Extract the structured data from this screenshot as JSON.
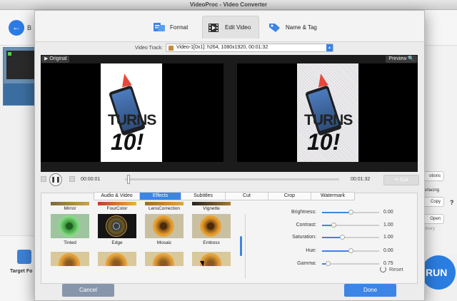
{
  "window_title": "VideoProc - Video Converter",
  "background": {
    "back_label": "B",
    "target_format_label": "Target Fo",
    "right_button_1": "otions",
    "right_text_1": "erlacing",
    "right_button_2": "Copy",
    "right_help": "?",
    "right_button_3": "Open",
    "right_text_2": "ibrary",
    "run_label": "RUN"
  },
  "tabs": [
    {
      "label": "Format",
      "icon": "format-icon"
    },
    {
      "label": "Edit Video",
      "icon": "film-icon"
    },
    {
      "label": "Name & Tag",
      "icon": "tag-icon"
    }
  ],
  "active_tab": "Edit Video",
  "video_track": {
    "label": "Video Track:",
    "value": "Video-1[0x1]: h264, 1080x1920, 00:01:32"
  },
  "preview": {
    "original_label": "Original",
    "preview_label": "Preview",
    "overlay_line1": "TURNS",
    "overlay_line2": "10!"
  },
  "timeline": {
    "current_time": "00:00:01",
    "total_time": "00:01:32",
    "progress": 0.01,
    "cut_label": "Cut"
  },
  "subtabs": [
    "Audio & Video",
    "Effects",
    "Subtitles",
    "Cut",
    "Crop",
    "Watermark"
  ],
  "active_subtab": "Effects",
  "effects": [
    {
      "label": "Mirror"
    },
    {
      "label": "FourColor"
    },
    {
      "label": "LensCorrection"
    },
    {
      "label": "Vignette"
    },
    {
      "label": "Tinted"
    },
    {
      "label": "Edge"
    },
    {
      "label": "Mosaic"
    },
    {
      "label": "Emboss"
    }
  ],
  "adjustments": [
    {
      "label": "Brightness:",
      "value": "0.00",
      "level": 0.5
    },
    {
      "label": "Contrast:",
      "value": "1.00",
      "level": 0.2
    },
    {
      "label": "Saturation:",
      "value": "1.00",
      "level": 0.35
    },
    {
      "label": "Hue:",
      "value": "0.00",
      "level": 0.5
    },
    {
      "label": "Gamma:",
      "value": "0.75",
      "level": 0.1
    }
  ],
  "reset_label": "Reset",
  "cancel_label": "Cancel",
  "done_label": "Done",
  "colors": {
    "accent": "#3c84e6",
    "cancel": "#8896ac"
  }
}
